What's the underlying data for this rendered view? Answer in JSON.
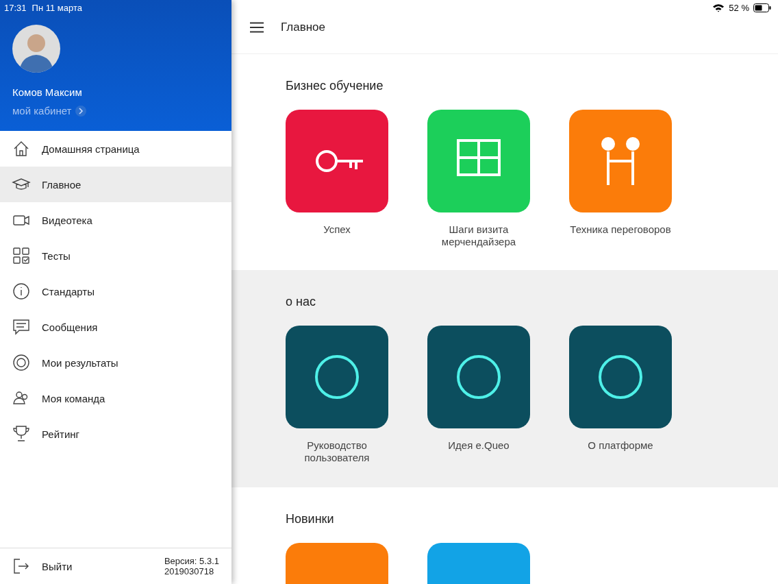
{
  "status_bar": {
    "time": "17:31",
    "date": "Пн 11 марта",
    "battery": "52 %"
  },
  "sidebar": {
    "user": {
      "name": "Комов Максим",
      "link": "мой кабинет"
    },
    "items": [
      {
        "label": "Домашняя страница",
        "selected": false
      },
      {
        "label": "Главное",
        "selected": true
      },
      {
        "label": "Видеотека",
        "selected": false
      },
      {
        "label": "Тесты",
        "selected": false
      },
      {
        "label": "Стандарты",
        "selected": false
      },
      {
        "label": "Сообщения",
        "selected": false
      },
      {
        "label": "Мои результаты",
        "selected": false
      },
      {
        "label": "Моя команда",
        "selected": false
      },
      {
        "label": "Рейтинг",
        "selected": false
      }
    ],
    "logout": "Выйти",
    "version": [
      "Версия: 5.3.1",
      "2019030718"
    ]
  },
  "header": {
    "title": "Главное"
  },
  "sections": [
    {
      "title": "Бизнес обучение",
      "items": [
        {
          "label": "Успех",
          "color": "#e8173f"
        },
        {
          "label": "Шаги визита мерчендайзера",
          "color": "#1ccf5a"
        },
        {
          "label": "Техника переговоров",
          "color": "#fb7c0a"
        }
      ]
    },
    {
      "title": "о нас",
      "items": [
        {
          "label": "Руководство пользователя",
          "color": "#0c4e5e"
        },
        {
          "label": "Идея e.Queo",
          "color": "#0c4e5e"
        },
        {
          "label": "О платформе",
          "color": "#0c4e5e"
        }
      ]
    },
    {
      "title": "Новинки",
      "items": [
        {
          "color": "#fb7c0a"
        },
        {
          "color": "#12a3e6"
        }
      ]
    }
  ]
}
